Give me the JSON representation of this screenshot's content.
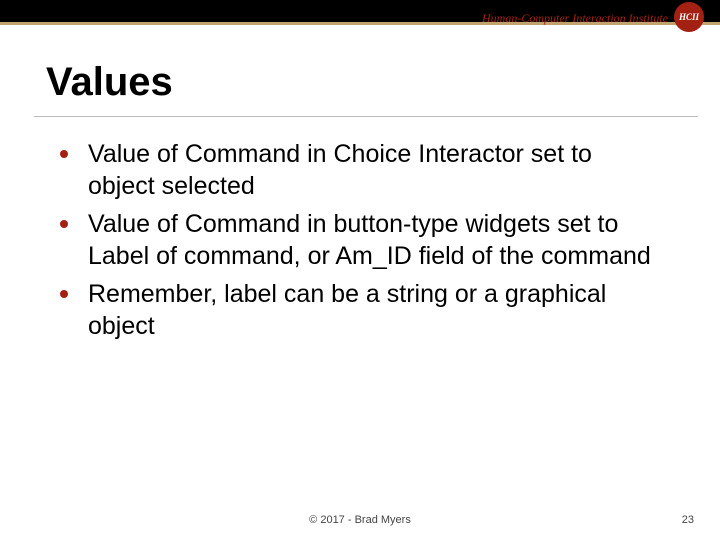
{
  "header": {
    "institute": "Human-Computer Interaction Institute",
    "logo_abbrev": "HCII"
  },
  "title": "Values",
  "bullets": [
    "Value of Command in Choice Interactor set to object selected",
    "Value of Command in button-type widgets set to Label of command, or Am_ID field of the command",
    "Remember, label can be a string or a graphical object"
  ],
  "footer": {
    "copyright": "© 2017 - Brad Myers",
    "page": "23"
  },
  "colors": {
    "accent": "#a32113",
    "gold": "#c0a36e"
  }
}
